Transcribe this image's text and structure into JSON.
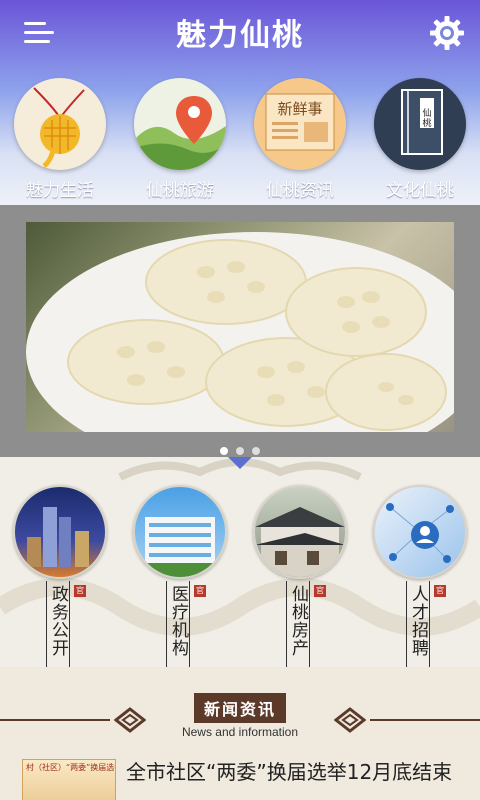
{
  "header": {
    "title": "魅力仙桃",
    "menu_icon": "menu-icon",
    "settings_icon": "gear-icon"
  },
  "top_nav": [
    {
      "label": "魅力生活",
      "icon": "knot-charm-icon"
    },
    {
      "label": "仙桃旅游",
      "icon": "map-pin-icon"
    },
    {
      "label": "仙桃资讯",
      "icon": "newspaper-icon"
    },
    {
      "label": "文化仙桃",
      "icon": "book-icon"
    }
  ],
  "banner": {
    "image": "lotus-root-slices-photo",
    "dots": 3,
    "active_dot": 1
  },
  "services": [
    {
      "label": "政务公开",
      "tag": "官",
      "image": "city-night-photo"
    },
    {
      "label": "医疗机构",
      "tag": "官",
      "image": "hospital-building-photo"
    },
    {
      "label": "仙桃房产",
      "tag": "官",
      "image": "tiled-roofs-photo"
    },
    {
      "label": "人才招聘",
      "tag": "官",
      "image": "network-people-photo"
    }
  ],
  "news": {
    "title": "新闻资讯",
    "subtitle": "News and information",
    "item": {
      "text": "全市社区“两委”换届选举12月底结束",
      "thumb_text": "村（社区）“两委”换届选举工"
    }
  }
}
